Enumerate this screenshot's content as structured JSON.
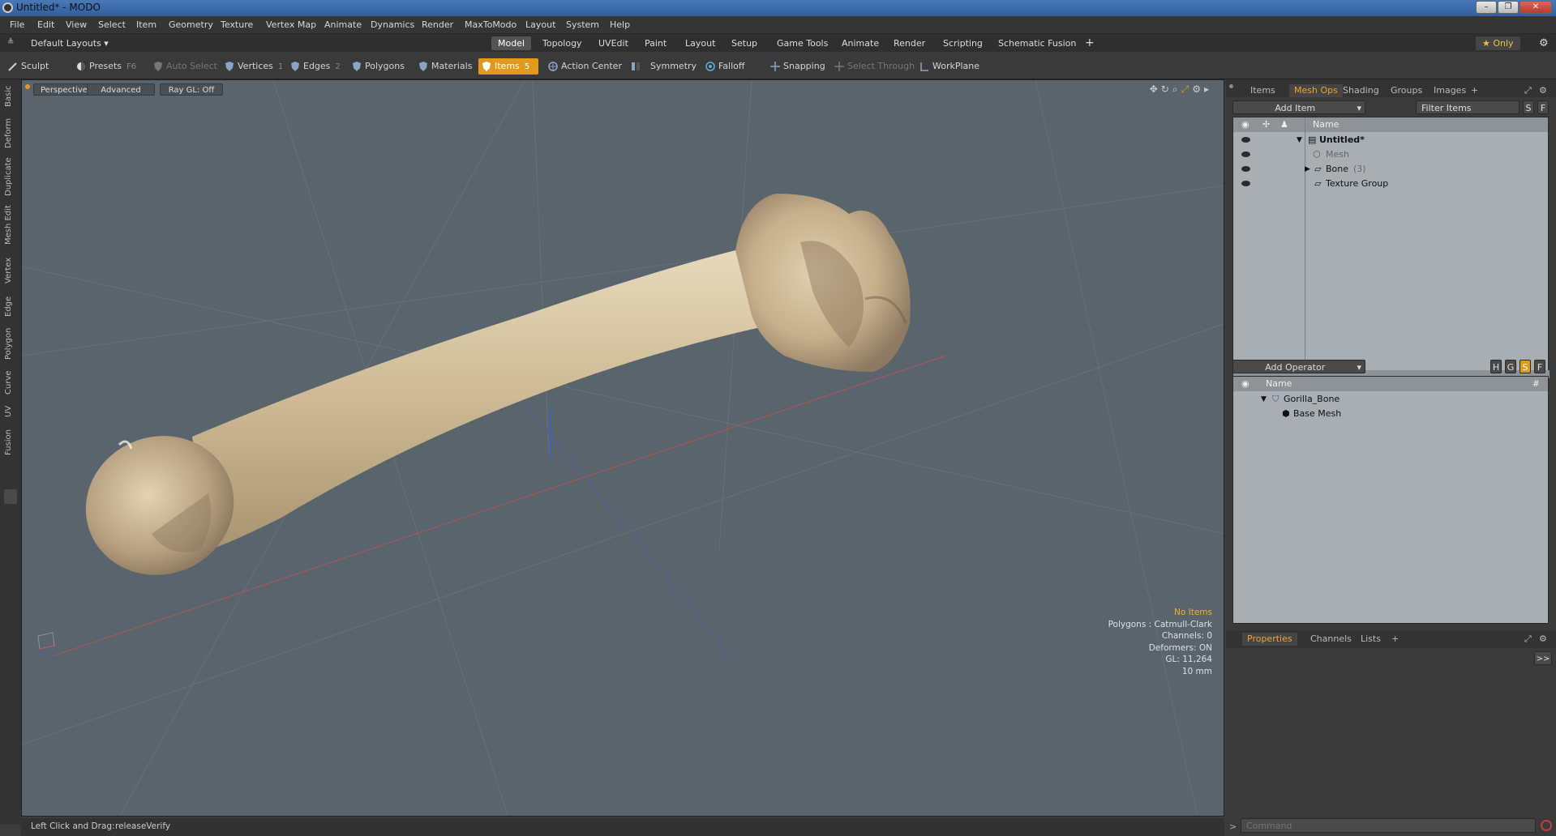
{
  "window": {
    "title": "Untitled* - MODO",
    "min": "–",
    "max": "❐",
    "close": "✕"
  },
  "menu": [
    "File",
    "Edit",
    "View",
    "Select",
    "Item",
    "Geometry",
    "Texture",
    "Vertex Map",
    "Animate",
    "Dynamics",
    "Render",
    "MaxToModo",
    "Layout",
    "System",
    "Help"
  ],
  "layouts": {
    "default_label": "Default Layouts ▾",
    "tabs": [
      "Model",
      "Topology",
      "UVEdit",
      "Paint",
      "Layout",
      "Setup",
      "Game Tools",
      "Animate",
      "Render",
      "Scripting",
      "Schematic Fusion"
    ],
    "active": "Model",
    "add": "+",
    "only_label": "★ Only"
  },
  "toolbar": {
    "sculpt": "Sculpt",
    "presets": "Presets",
    "presets_key": "F6",
    "auto_select": "Auto Select",
    "vertices": "Vertices",
    "vertices_key": "1",
    "edges": "Edges",
    "edges_key": "2",
    "polygons": "Polygons",
    "materials": "Materials",
    "items": "Items",
    "items_key": "5",
    "action_center": "Action Center",
    "symmetry": "Symmetry",
    "falloff": "Falloff",
    "snapping": "Snapping",
    "select_through": "Select Through",
    "workplane": "WorkPlane"
  },
  "left_tabs": [
    "Basic",
    "Deform",
    "Duplicate",
    "Mesh Edit",
    "Vertex",
    "Edge",
    "Polygon",
    "Curve",
    "UV",
    "Fusion"
  ],
  "viewport": {
    "projection": "Perspective",
    "shading": "Advanced",
    "raygl": "Ray GL: Off",
    "stats": {
      "selection": "No Items",
      "polygons": "Polygons : Catmull-Clark",
      "channels": "Channels: 0",
      "deformers": "Deformers: ON",
      "gl": "GL: 11,264",
      "unit": "10 mm"
    }
  },
  "status": {
    "hint": "Left Click and Drag:",
    "action": "releaseVerify"
  },
  "items_panel": {
    "tabs": [
      "Items",
      "Mesh Ops",
      "Shading",
      "Groups",
      "Images",
      "+"
    ],
    "active": "Mesh Ops",
    "add_item": "Add Item",
    "filter": "Filter Items",
    "s_btn": "S",
    "f_btn": "F",
    "col_name": "Name",
    "rows": [
      {
        "label": "Untitled*",
        "indent": 0
      },
      {
        "label": "Mesh",
        "indent": 1
      },
      {
        "label": "Bone",
        "count": "(3)",
        "indent": 1
      },
      {
        "label": "Texture Group",
        "indent": 1
      }
    ]
  },
  "meshops_panel": {
    "add_operator": "Add Operator",
    "col_name": "Name",
    "col_hash": "#",
    "h_btn": "H",
    "g_btn": "G",
    "s_btn": "S",
    "f_btn": "F",
    "rows": [
      {
        "label": "Gorilla_Bone"
      },
      {
        "label": "Base Mesh"
      }
    ]
  },
  "properties_panel": {
    "tabs": [
      "Properties",
      "Channels",
      "Lists",
      "+"
    ],
    "active": "Properties",
    "expand": ">>"
  },
  "command": {
    "placeholder": "Command",
    "prompt": ">"
  },
  "colors": {
    "accent": "#e09a1c",
    "viewport_bg": "#5a646c",
    "bone": "#d9c9a6"
  }
}
